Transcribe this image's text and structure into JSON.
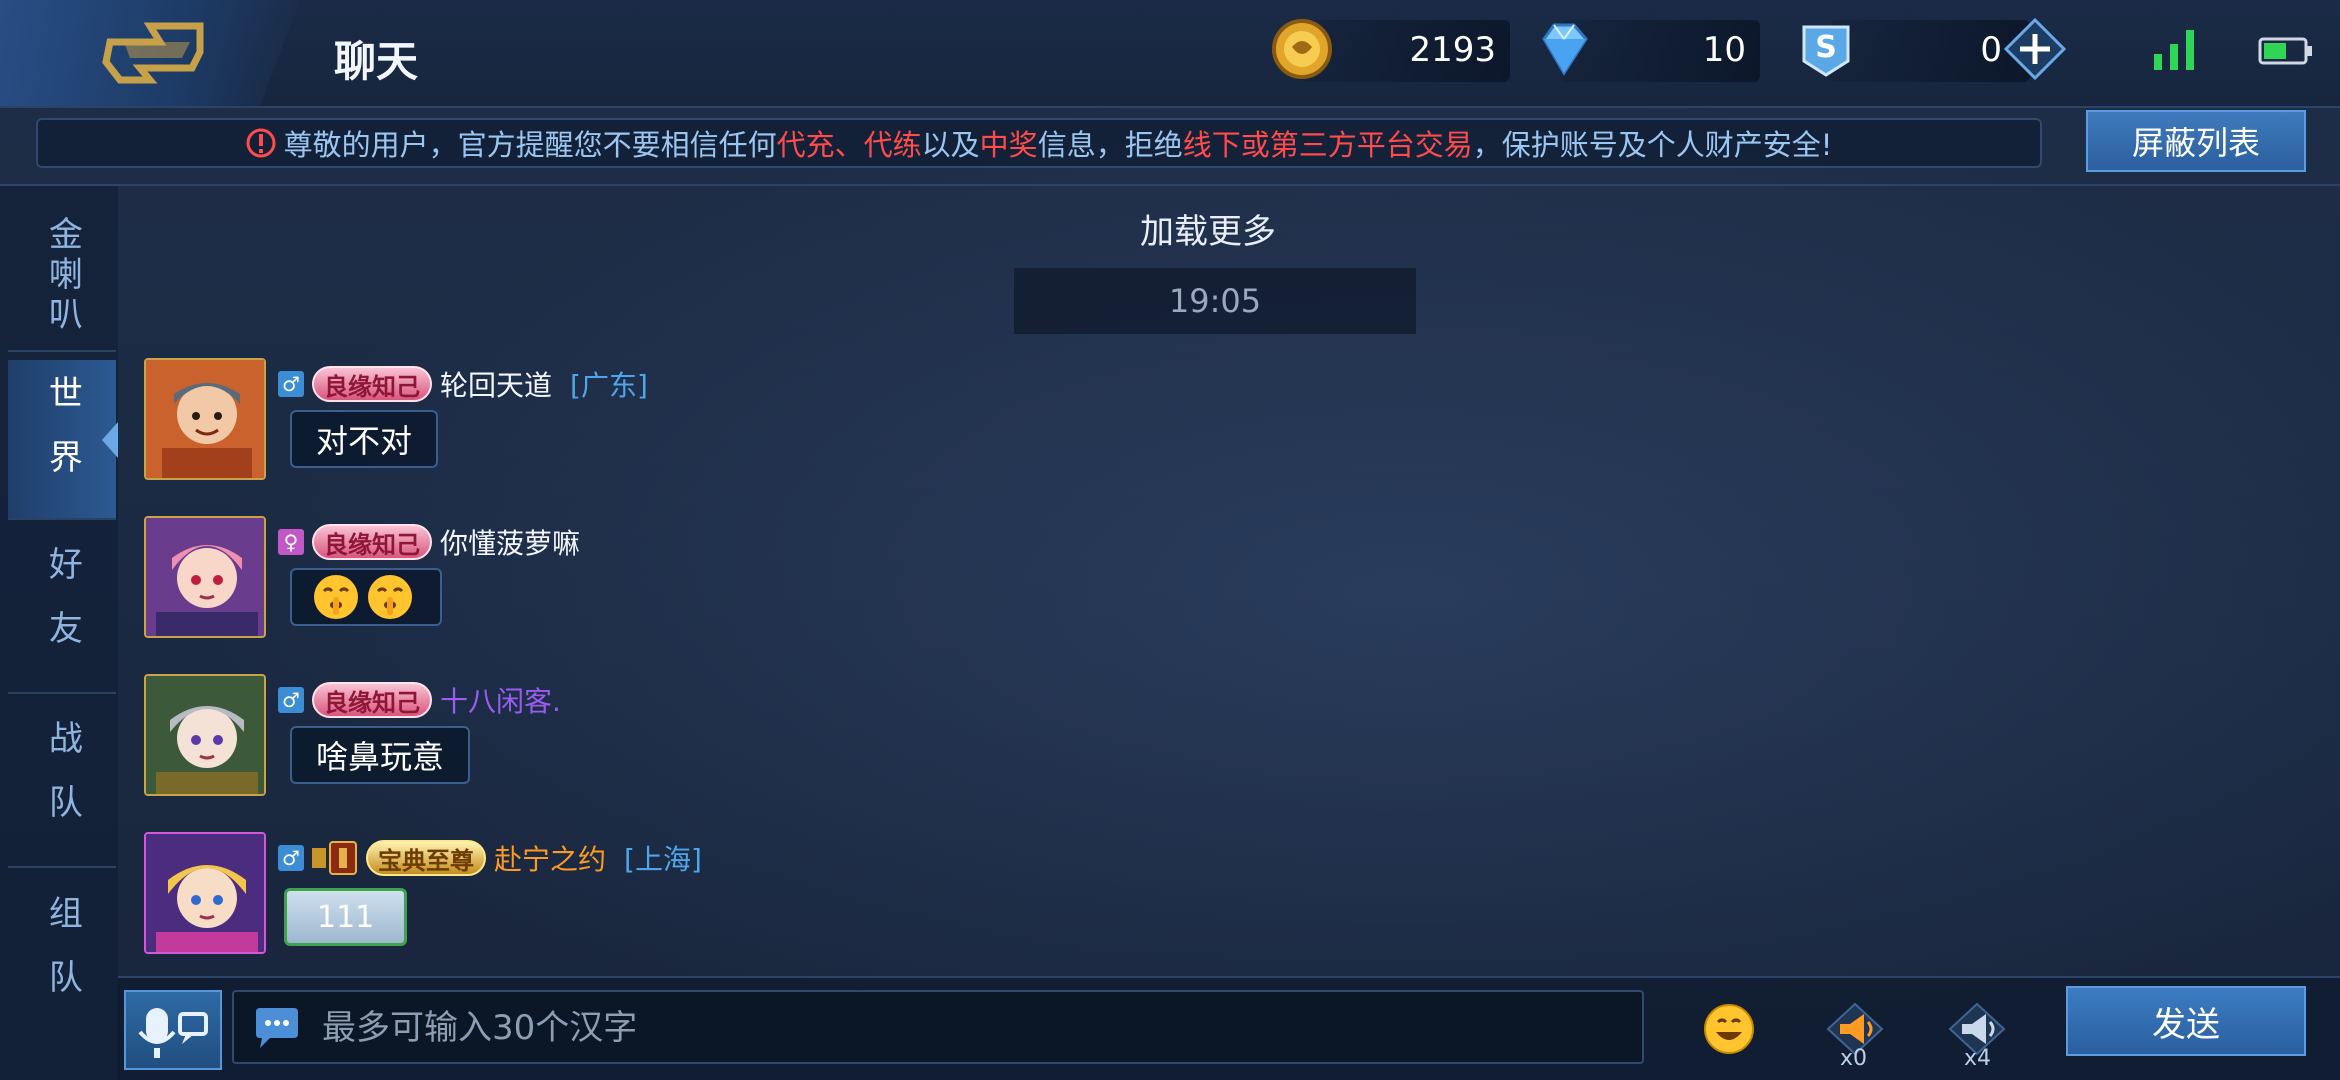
{
  "header": {
    "title": "聊天",
    "gold": "2193",
    "diamonds": "10",
    "coupons": "0"
  },
  "notice": {
    "parts": [
      {
        "text": "尊敬的用户，官方提醒您不要相信任何",
        "red": false
      },
      {
        "text": "代充、代练",
        "red": true
      },
      {
        "text": "以及",
        "red": false
      },
      {
        "text": "中奖",
        "red": true
      },
      {
        "text": "信息，拒绝",
        "red": false
      },
      {
        "text": "线下或第三方平台交易",
        "red": true
      },
      {
        "text": "，保护账号及个人财产安全!",
        "red": false
      }
    ],
    "block_list_label": "屏蔽列表"
  },
  "sidebar": {
    "tabs": [
      {
        "label": "金喇叭",
        "active": false
      },
      {
        "label": "世界",
        "active": true
      },
      {
        "label": "好友",
        "active": false
      },
      {
        "label": "战队",
        "active": false
      },
      {
        "label": "组队",
        "active": false
      }
    ]
  },
  "chat": {
    "load_more": "加载更多",
    "time": "19:05",
    "messages": [
      {
        "gender": "♂",
        "tag": "良缘知己",
        "name": "轮回天道",
        "region": "[广东]",
        "text": "对不对"
      },
      {
        "gender": "♀",
        "tag": "良缘知己",
        "name": "你懂菠萝嘛",
        "region": "",
        "text": ""
      },
      {
        "gender": "♂",
        "tag": "良缘知己",
        "name": "十八闲客.",
        "region": "",
        "text": "啥鼻玩意"
      },
      {
        "gender": "♂",
        "tag": "宝典至尊",
        "name": "赴宁之约",
        "region": "[上海]",
        "text": "111"
      }
    ]
  },
  "input": {
    "placeholder": "最多可输入30个汉字",
    "horn_count": "x0",
    "speaker_count": "x4",
    "send_label": "发送"
  },
  "colors": {
    "accent": "#2c5a93",
    "warning_red": "#ff4b4b",
    "notice_blue": "#9cc6f2"
  }
}
